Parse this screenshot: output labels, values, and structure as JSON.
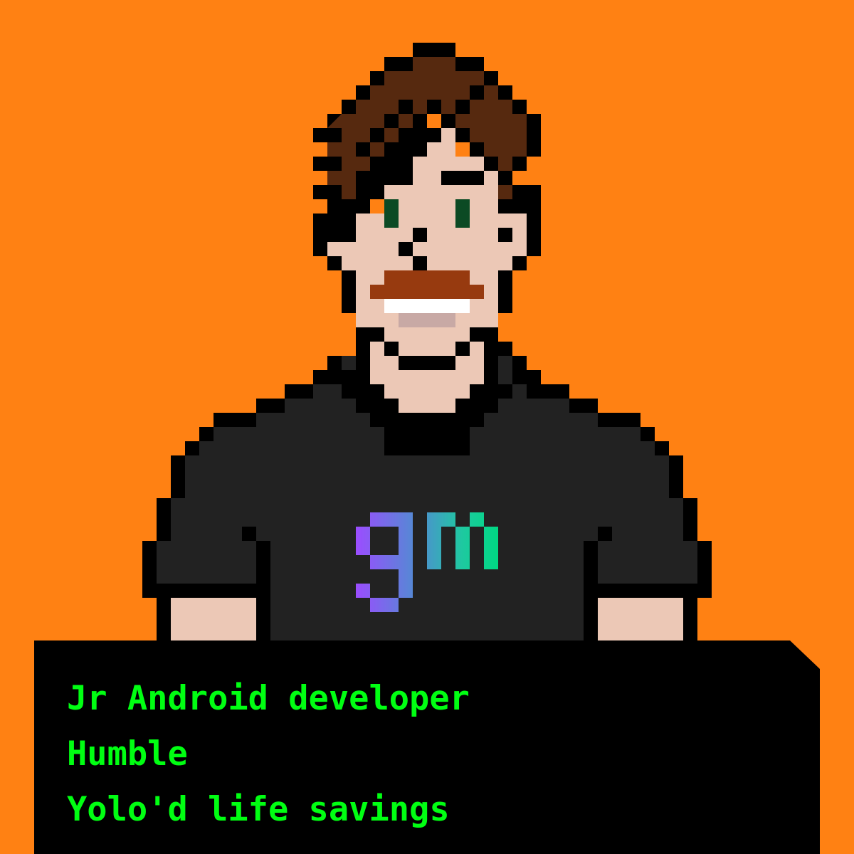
{
  "colors": {
    "background": "#FF8113",
    "outline": "#000000",
    "skin": "#ECC8B6",
    "hair": "#56290F",
    "eyes": "#0C4A24",
    "mustache": "#973A0F",
    "teeth": "#FFFFFF",
    "lip": "#C8A9A5",
    "shirt": "#222222",
    "panel": "#000000",
    "trait_text": "#00FF12",
    "logo_gradient": [
      "#9B4DFF",
      "#4E8FD0",
      "#1EC9A0",
      "#00D883"
    ]
  },
  "avatar": {
    "style": "pixel-art",
    "shirt_logo": "gm",
    "icons": [
      "hair",
      "eyes",
      "mustache",
      "shirt-logo"
    ]
  },
  "traits": [
    "Jr Android developer",
    "Humble",
    "Yolo'd life savings"
  ]
}
